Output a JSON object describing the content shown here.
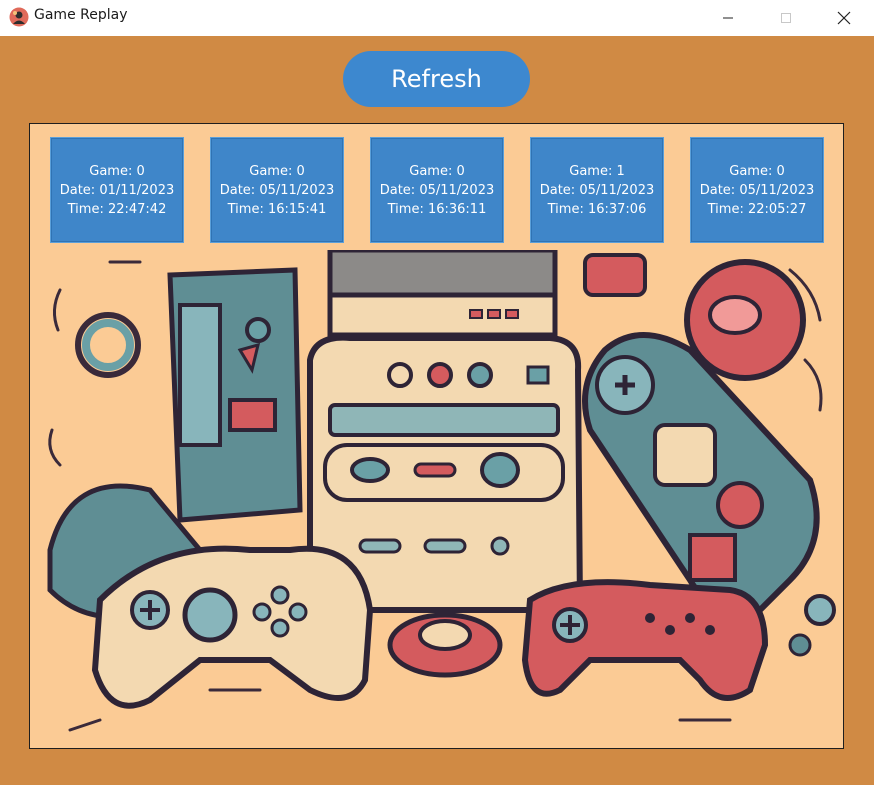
{
  "window": {
    "title": "Game Replay",
    "icon": "app-avatar-icon"
  },
  "toolbar": {
    "refresh_label": "Refresh"
  },
  "replays": [
    {
      "game": "Game: 0",
      "date": "Date: 01/11/2023",
      "time": "Time: 22:47:42"
    },
    {
      "game": "Game: 0",
      "date": "Date: 05/11/2023",
      "time": "Time: 16:15:41"
    },
    {
      "game": "Game: 0",
      "date": "Date: 05/11/2023",
      "time": "Time: 16:36:11"
    },
    {
      "game": "Game: 1",
      "date": "Date: 05/11/2023",
      "time": "Time: 16:37:06"
    },
    {
      "game": "Game: 0",
      "date": "Date: 05/11/2023",
      "time": "Time: 22:05:27"
    }
  ],
  "colors": {
    "background": "#d08a44",
    "button": "#3d88cf",
    "card": "#3f86c9",
    "panel": "#fbcb95"
  }
}
